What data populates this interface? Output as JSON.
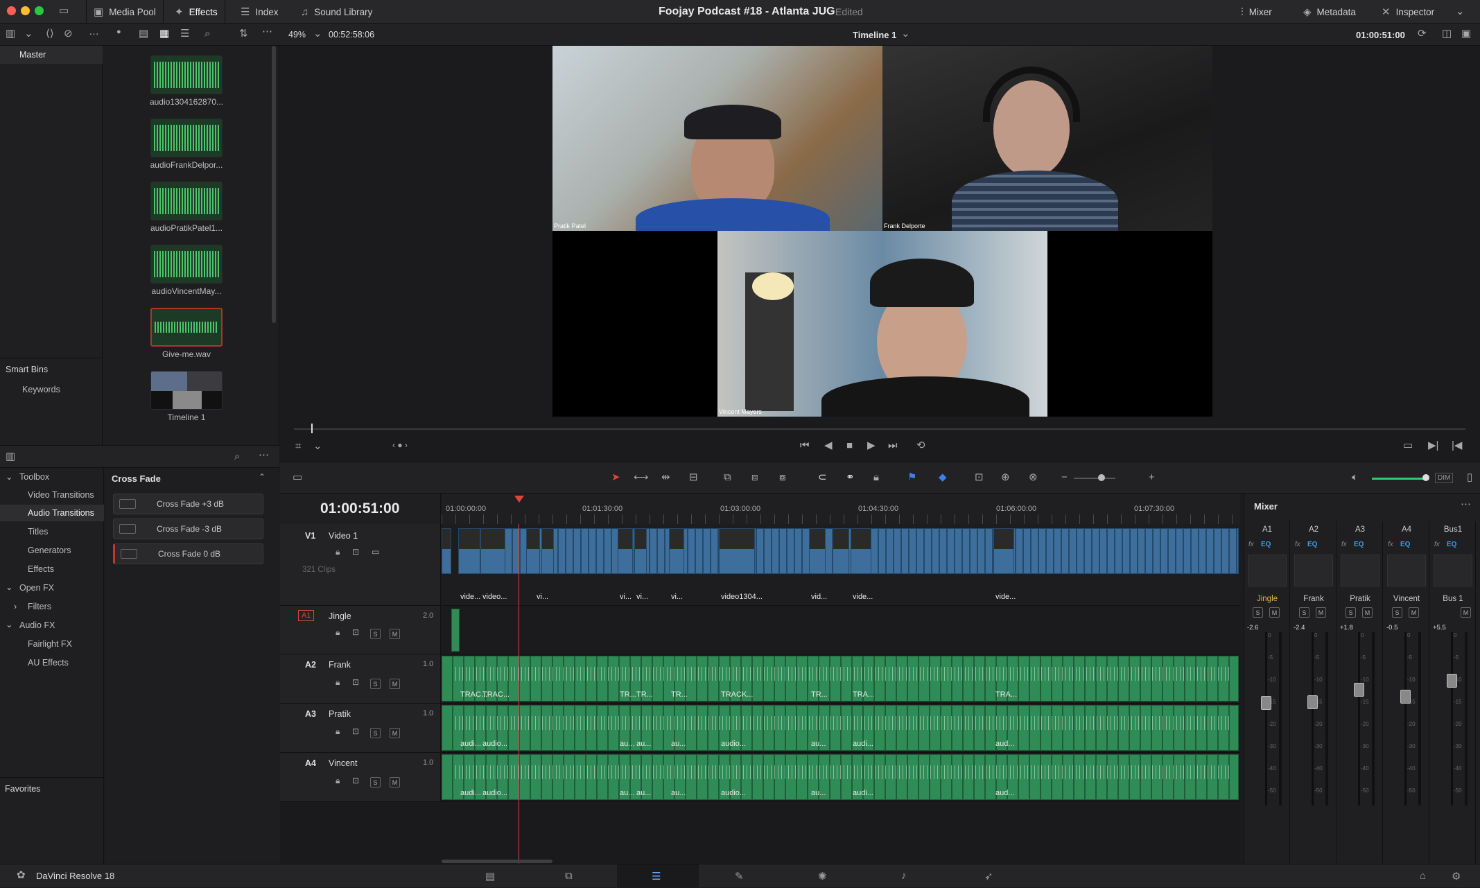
{
  "app": {
    "name": "DaVinci Resolve 18"
  },
  "topbar": {
    "media_pool": "Media Pool",
    "effects": "Effects",
    "index": "Index",
    "sound_library": "Sound Library",
    "project_title": "Foojay Podcast #18 - Atlanta JUG",
    "status": "Edited",
    "mixer": "Mixer",
    "metadata": "Metadata",
    "inspector": "Inspector"
  },
  "toolbar2": {
    "zoom": "49%",
    "source_timecode": "00:52:58:06",
    "timeline_name": "Timeline 1",
    "record_timecode": "01:00:51:00"
  },
  "bins": {
    "master": "Master",
    "smart_bins": "Smart Bins",
    "keywords": "Keywords",
    "favorites": "Favorites"
  },
  "media_clips": [
    {
      "name": "audio1304162870..."
    },
    {
      "name": "audioFrankDelpor..."
    },
    {
      "name": "audioPratikPatel1..."
    },
    {
      "name": "audioVincentMay..."
    },
    {
      "name": "Give-me.wav"
    },
    {
      "name": "Timeline 1"
    }
  ],
  "viewer": {
    "participants": [
      "Pratik Patel",
      "Frank Delporte",
      "Vincent Mayers"
    ]
  },
  "effects_tree": {
    "toolbox": "Toolbox",
    "video_transitions": "Video Transitions",
    "audio_transitions": "Audio Transitions",
    "titles": "Titles",
    "generators": "Generators",
    "effects": "Effects",
    "open_fx": "Open FX",
    "filters": "Filters",
    "audio_fx": "Audio FX",
    "fairlight_fx": "Fairlight FX",
    "au_effects": "AU Effects"
  },
  "effects_list": {
    "header": "Cross Fade",
    "items": [
      "Cross Fade +3 dB",
      "Cross Fade -3 dB",
      "Cross Fade 0 dB"
    ]
  },
  "timeline": {
    "current_timecode": "01:00:51:00",
    "ruler": [
      "01:00:00:00",
      "01:01:30:00",
      "01:03:00:00",
      "01:04:30:00",
      "01:06:00:00",
      "01:07:30:00"
    ],
    "tracks": [
      {
        "id": "V1",
        "name": "Video 1",
        "info": "321 Clips"
      },
      {
        "id": "A1",
        "name": "Jingle",
        "level": "2.0"
      },
      {
        "id": "A2",
        "name": "Frank",
        "level": "1.0"
      },
      {
        "id": "A3",
        "name": "Pratik",
        "level": "1.0"
      },
      {
        "id": "A4",
        "name": "Vincent",
        "level": "1.0"
      }
    ],
    "video_clip_labels": [
      "vide...",
      "video...",
      "vi...",
      "vi...",
      "vi...",
      "vi...",
      "video1304...",
      "vid...",
      "vide...",
      "vide..."
    ],
    "a2_clip_labels": [
      "TRAC...",
      "TRAC...",
      "TR...",
      "TR...",
      "TR...",
      "TRACK...",
      "TR...",
      "TRA...",
      "TRA..."
    ],
    "a3_clip_labels": [
      "audi...",
      "audio...",
      "au...",
      "au...",
      "au...",
      "audio...",
      "au...",
      "audi...",
      "aud..."
    ],
    "a4_clip_labels": [
      "audi...",
      "audio...",
      "au...",
      "au...",
      "au...",
      "audio...",
      "au...",
      "audi...",
      "aud..."
    ],
    "solo": "S",
    "mute": "M",
    "fx": "fx"
  },
  "mixer": {
    "title": "Mixer",
    "channels": [
      {
        "id": "A1",
        "name": "Jingle",
        "level": "-2.6",
        "eq": "EQ"
      },
      {
        "id": "A2",
        "name": "Frank",
        "level": "-2.4",
        "eq": "EQ"
      },
      {
        "id": "A3",
        "name": "Pratik",
        "level": "+1.8",
        "eq": "EQ"
      },
      {
        "id": "A4",
        "name": "Vincent",
        "level": "-0.5",
        "eq": "EQ"
      },
      {
        "id": "Bus1",
        "name": "Bus 1",
        "level": "+5.5",
        "eq": "EQ"
      }
    ],
    "scale": [
      "0",
      "-5",
      "-10",
      "-15",
      "-20",
      "-30",
      "-40",
      "-50"
    ],
    "dim": "DIM"
  },
  "colors": {
    "video_clip": "#3d6e9c",
    "audio_clip": "#2f8c56",
    "playhead": "#e0433b",
    "jingle_label": "#e8b33c"
  }
}
